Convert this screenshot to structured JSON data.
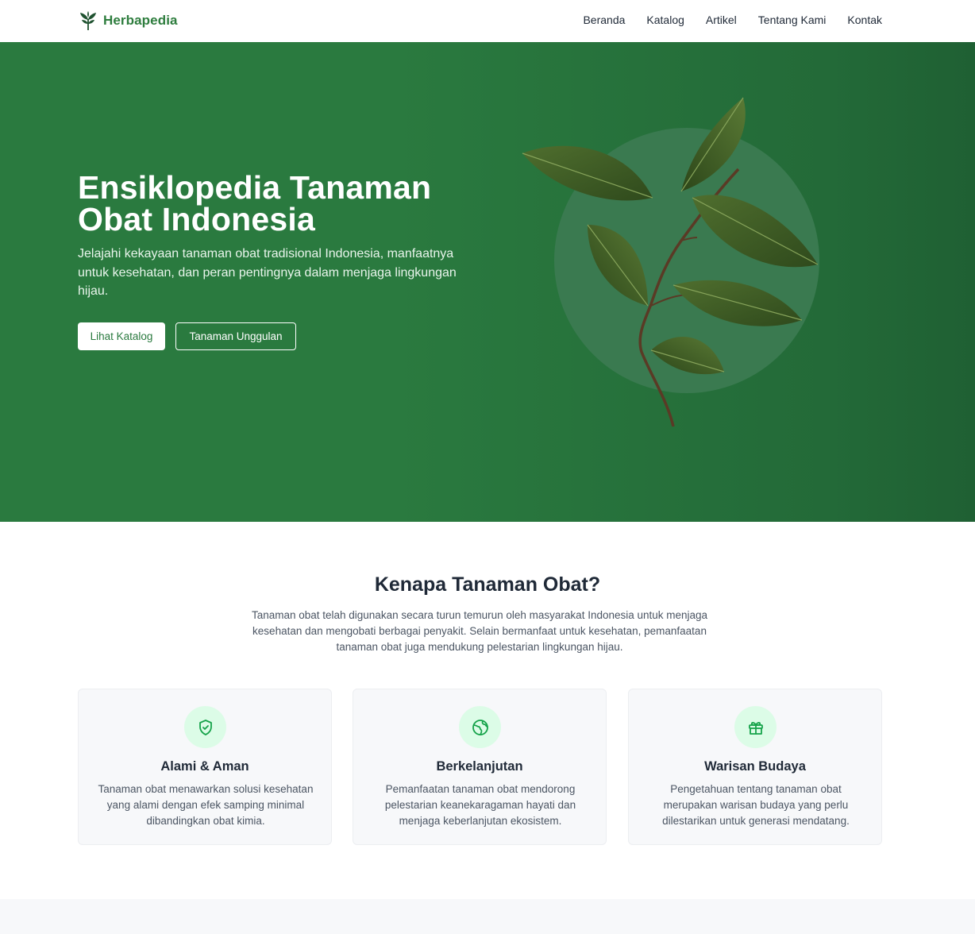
{
  "header": {
    "brand": "Herbapedia",
    "nav": [
      "Beranda",
      "Katalog",
      "Artikel",
      "Tentang Kami",
      "Kontak"
    ]
  },
  "hero": {
    "title_line1": "Ensiklopedia Tanaman",
    "title_line2": "Obat Indonesia",
    "subtitle": "Jelajahi kekayaan tanaman obat tradisional Indonesia, manfaatnya untuk kesehatan, dan peran pentingnya dalam menjaga lingkungan hijau.",
    "primary_button": "Lihat Katalog",
    "secondary_button": "Tanaman Unggulan",
    "image": "leafy-branch-illustration"
  },
  "why": {
    "title": "Kenapa Tanaman Obat?",
    "description": "Tanaman obat telah digunakan secara turun temurun oleh masyarakat Indonesia untuk menjaga kesehatan dan mengobati berbagai penyakit. Selain bermanfaat untuk kesehatan, pemanfaatan tanaman obat juga mendukung pelestarian lingkungan hijau.",
    "cards": [
      {
        "icon": "shield-check-icon",
        "title": "Alami & Aman",
        "text": "Tanaman obat menawarkan solusi kesehatan yang alami dengan efek samping minimal dibandingkan obat kimia."
      },
      {
        "icon": "globe-icon",
        "title": "Berkelanjutan",
        "text": "Pemanfaatan tanaman obat mendorong pelestarian keanekaragaman hayati dan menjaga keberlanjutan ekosistem."
      },
      {
        "icon": "gift-icon",
        "title": "Warisan Budaya",
        "text": "Pengetahuan tentang tanaman obat merupakan warisan budaya yang perlu dilestarikan untuk generasi mendatang."
      }
    ]
  },
  "colors": {
    "primary": "#2a7a3f",
    "icon_bg": "#dcfce7",
    "icon_stroke": "#16a34a"
  }
}
